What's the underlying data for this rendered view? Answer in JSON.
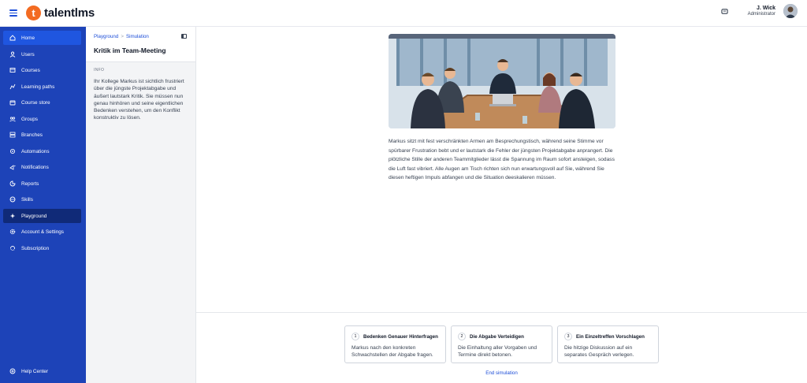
{
  "app": {
    "logo_letter": "t",
    "logo_text": "talentlms"
  },
  "user": {
    "name": "J. Wick",
    "role": "Administrator"
  },
  "sidebar": {
    "items": [
      {
        "label": "Home",
        "icon": "home-icon"
      },
      {
        "label": "Users",
        "icon": "user-icon"
      },
      {
        "label": "Courses",
        "icon": "courses-icon"
      },
      {
        "label": "Learning paths",
        "icon": "learning-paths-icon"
      },
      {
        "label": "Course store",
        "icon": "store-icon"
      },
      {
        "label": "Groups",
        "icon": "groups-icon"
      },
      {
        "label": "Branches",
        "icon": "branches-icon"
      },
      {
        "label": "Automations",
        "icon": "automations-icon"
      },
      {
        "label": "Notifications",
        "icon": "notifications-icon"
      },
      {
        "label": "Reports",
        "icon": "reports-icon"
      },
      {
        "label": "Skills",
        "icon": "skills-icon"
      },
      {
        "label": "Playground",
        "icon": "playground-icon"
      },
      {
        "label": "Account & Settings",
        "icon": "settings-icon"
      },
      {
        "label": "Subscription",
        "icon": "subscription-icon"
      }
    ],
    "help_label": "Help Center"
  },
  "panel": {
    "breadcrumb": {
      "parent": "Playground",
      "separator": ">",
      "current": "Simulation"
    },
    "title": "Kritik im Team-Meeting",
    "info_label": "INFO",
    "info_text": "Ihr Kollege Markus ist sichtlich frustriert über die jüngste Projektabgabe und äußert lautstark Kritik. Sie müssen nun genau hinhören und seine eigentlichen Bedenken verstehen, um den Konflikt konstruktiv zu lösen."
  },
  "main": {
    "narrative": "Markus sitzt mit fest verschränkten Armen am Besprechungstisch, während seine Stimme vor spürbarer Frustration bebt und er lautstark die Fehler der jüngsten Projektabgabe anprangert. Die plötzliche Stille der anderen Teammitglieder lässt die Spannung im Raum sofort ansteigen, sodass die Luft fast vibriert. Alle Augen am Tisch richten sich nun erwartungsvoll auf Sie, während Sie diesen heftigen Impuls abfangen und die Situation deeskalieren müssen.",
    "options": [
      {
        "num": "1",
        "title": "Bedenken Genauer Hinterfragen",
        "text": "Markus nach den konkreten Schwachstellen der Abgabe fragen."
      },
      {
        "num": "2",
        "title": "Die Abgabe Verteidigen",
        "text": "Die Einhaltung aller Vorgaben und Termine direkt betonen."
      },
      {
        "num": "3",
        "title": "Ein Einzeltreffen Vorschlagen",
        "text": "Die hitzige Diskussion auf ein separates Gespräch verlegen."
      }
    ],
    "end_label": "End simulation"
  },
  "colors": {
    "sidebar": "#1d43b8",
    "active_item": "#1f56e0",
    "playground_item": "#102a78",
    "accent": "#1d4ed8",
    "logo": "#f36b21"
  }
}
